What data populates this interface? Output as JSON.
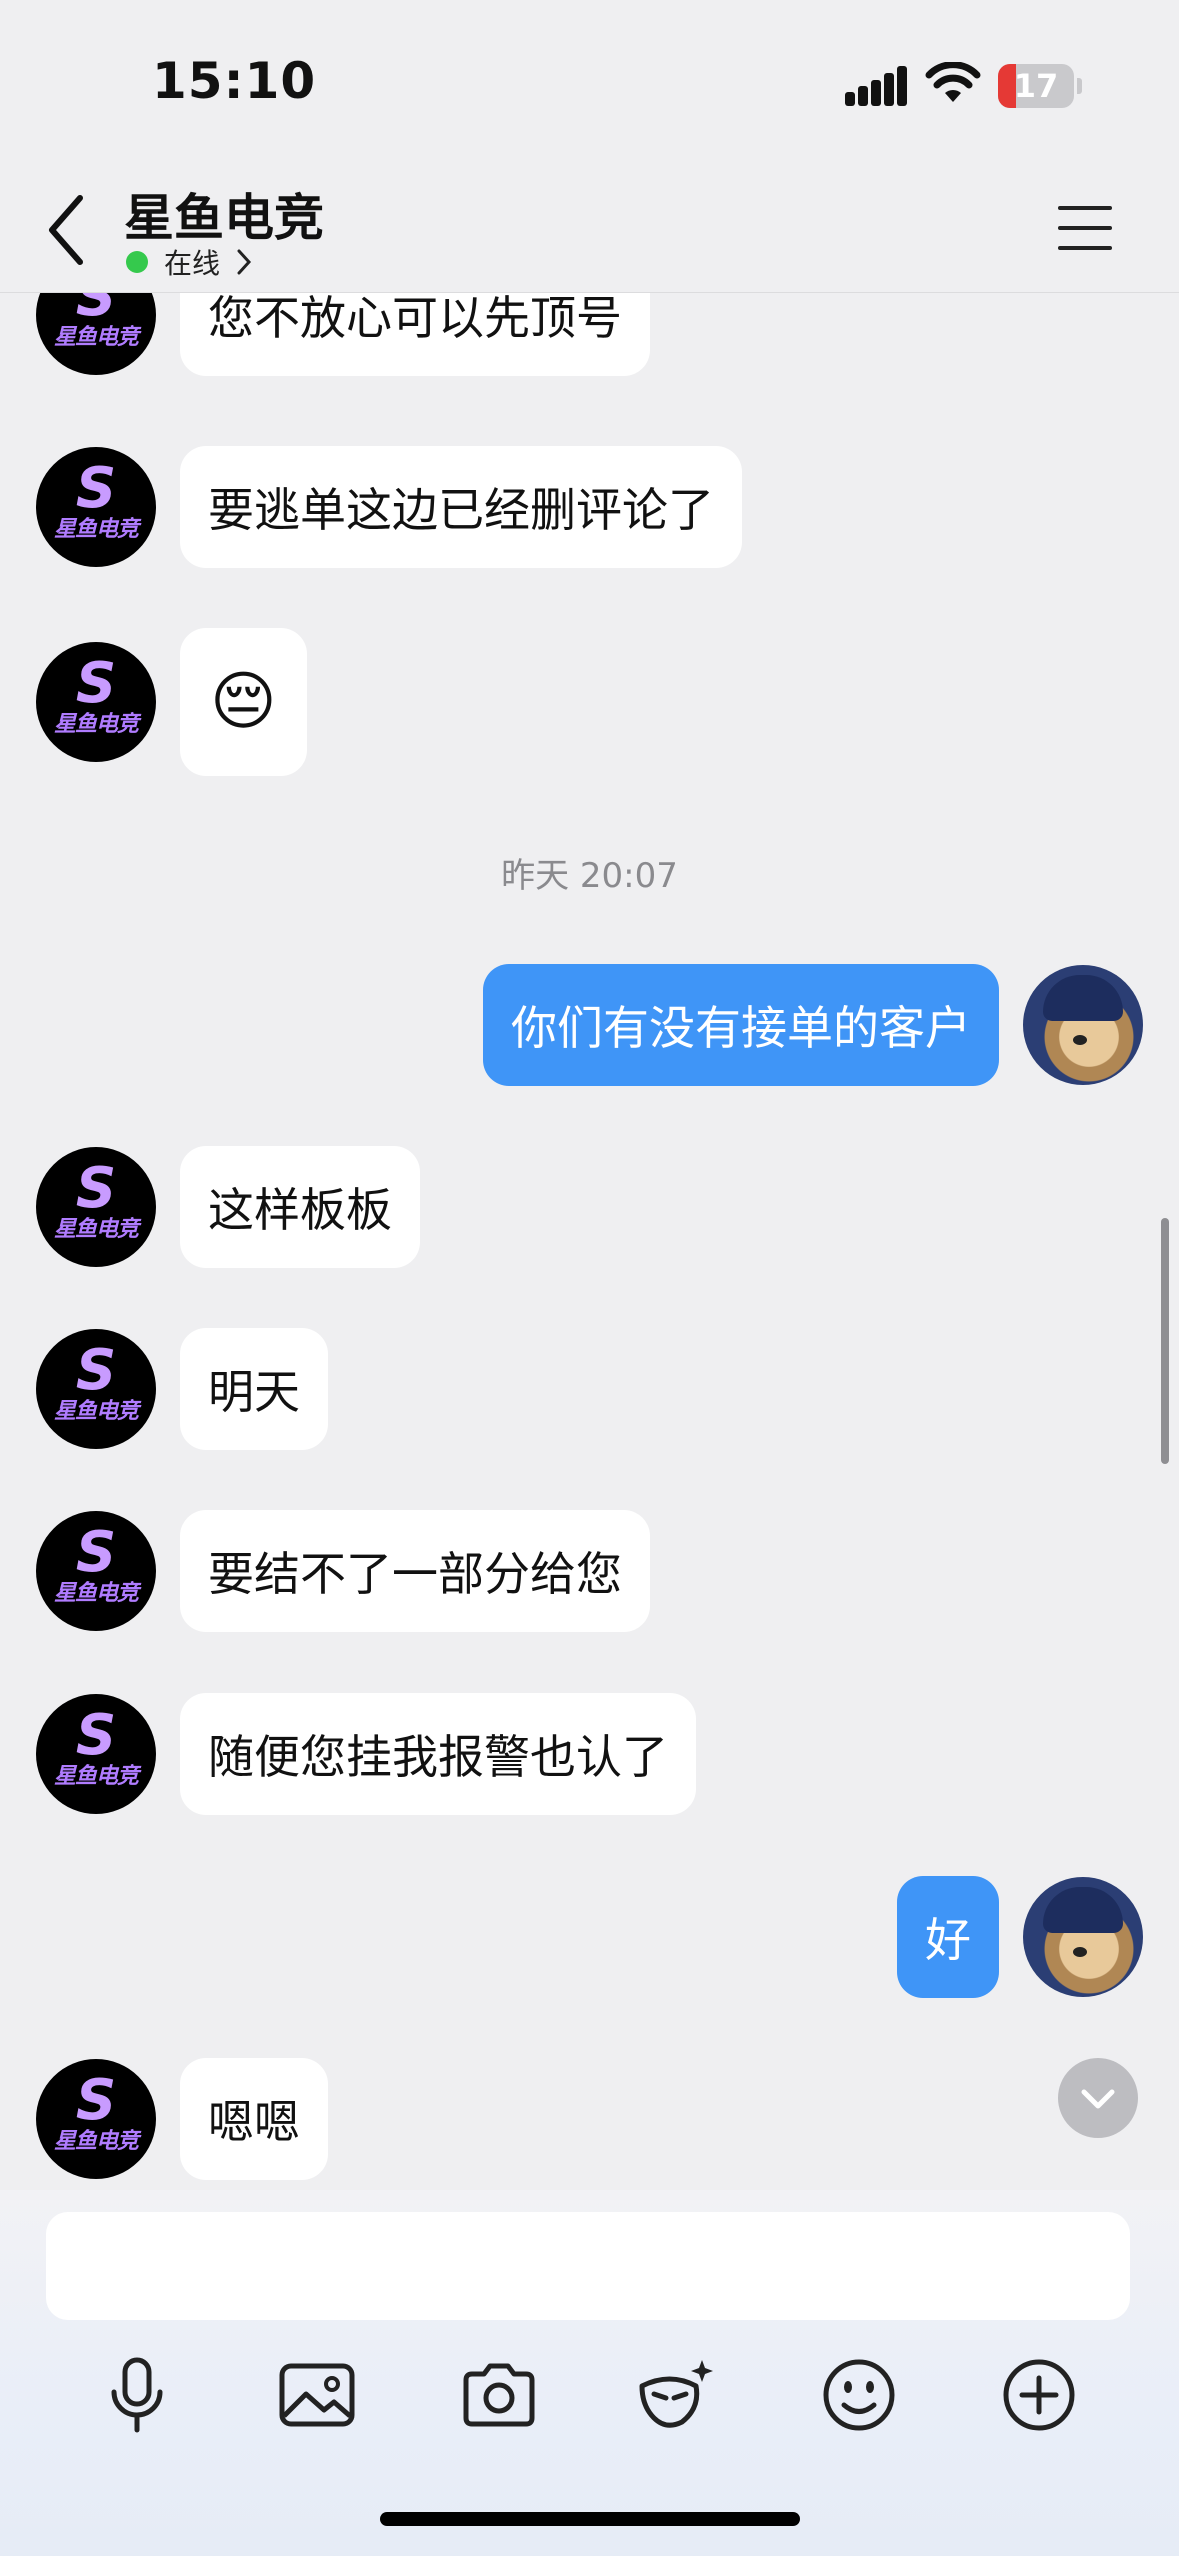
{
  "status_bar": {
    "time": "15:10",
    "battery_level": "17",
    "battery_color": "#e53935"
  },
  "header": {
    "title": "星鱼电竞",
    "status": "在线"
  },
  "avatar_logo": {
    "mark": "S",
    "text": "星鱼电竞"
  },
  "messages": [
    {
      "side": "left",
      "text": "您不放心可以先顶号"
    },
    {
      "side": "left",
      "text": "要逃单这边已经删评论了"
    },
    {
      "side": "left",
      "text": "😔"
    },
    {
      "type": "timestamp",
      "text": "昨天 20:07"
    },
    {
      "side": "right",
      "text": "你们有没有接单的客户"
    },
    {
      "side": "left",
      "text": "这样板板"
    },
    {
      "side": "left",
      "text": "明天"
    },
    {
      "side": "left",
      "text": "要结不了一部分给您"
    },
    {
      "side": "left",
      "text": "随便您挂我报警也认了"
    },
    {
      "side": "right",
      "text": "好"
    },
    {
      "side": "left",
      "text": "嗯嗯"
    }
  ],
  "toolbar_icons": [
    "microphone-icon",
    "image-icon",
    "camera-icon",
    "mask-icon",
    "emoji-icon",
    "plus-icon"
  ],
  "colors": {
    "accent": "#3f95f7",
    "online": "#35c94d",
    "background": "#efeff1"
  }
}
